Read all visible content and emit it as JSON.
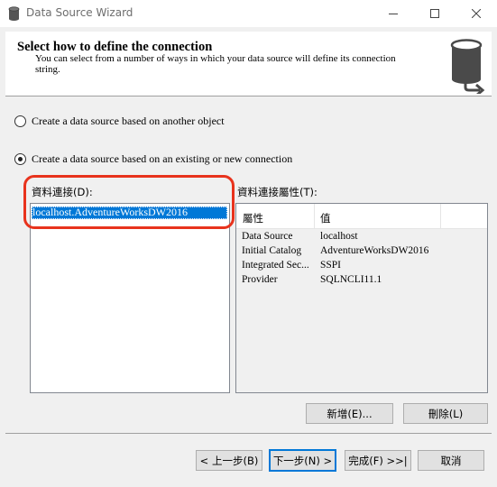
{
  "window": {
    "title": "Data Source Wizard"
  },
  "header": {
    "title": "Select how to define the connection",
    "subtitle": "You can select from a number of ways in which your data source will define its connection string."
  },
  "options": {
    "another_object": "Create a data source based on another object",
    "existing_connection": "Create a data source based on an existing or new connection"
  },
  "connections": {
    "label": "資料連接(D):",
    "items": [
      "localhost.AdventureWorksDW2016"
    ]
  },
  "properties": {
    "label": "資料連接屬性(T):",
    "col_property": "屬性",
    "col_value": "值",
    "rows": [
      {
        "key": "Data Source",
        "value": "localhost"
      },
      {
        "key": "Initial Catalog",
        "value": "AdventureWorksDW2016"
      },
      {
        "key": "Integrated Sec...",
        "value": "SSPI"
      },
      {
        "key": "Provider",
        "value": "SQLNCLI11.1"
      }
    ]
  },
  "buttons": {
    "new": "新增(E)...",
    "delete": "刪除(L)",
    "back": "< 上一步(B)",
    "next": "下一步(N) >",
    "finish": "完成(F) >>|",
    "cancel": "取消"
  },
  "colors": {
    "selection": "#0078d7",
    "highlight_ring": "#e8331d"
  }
}
